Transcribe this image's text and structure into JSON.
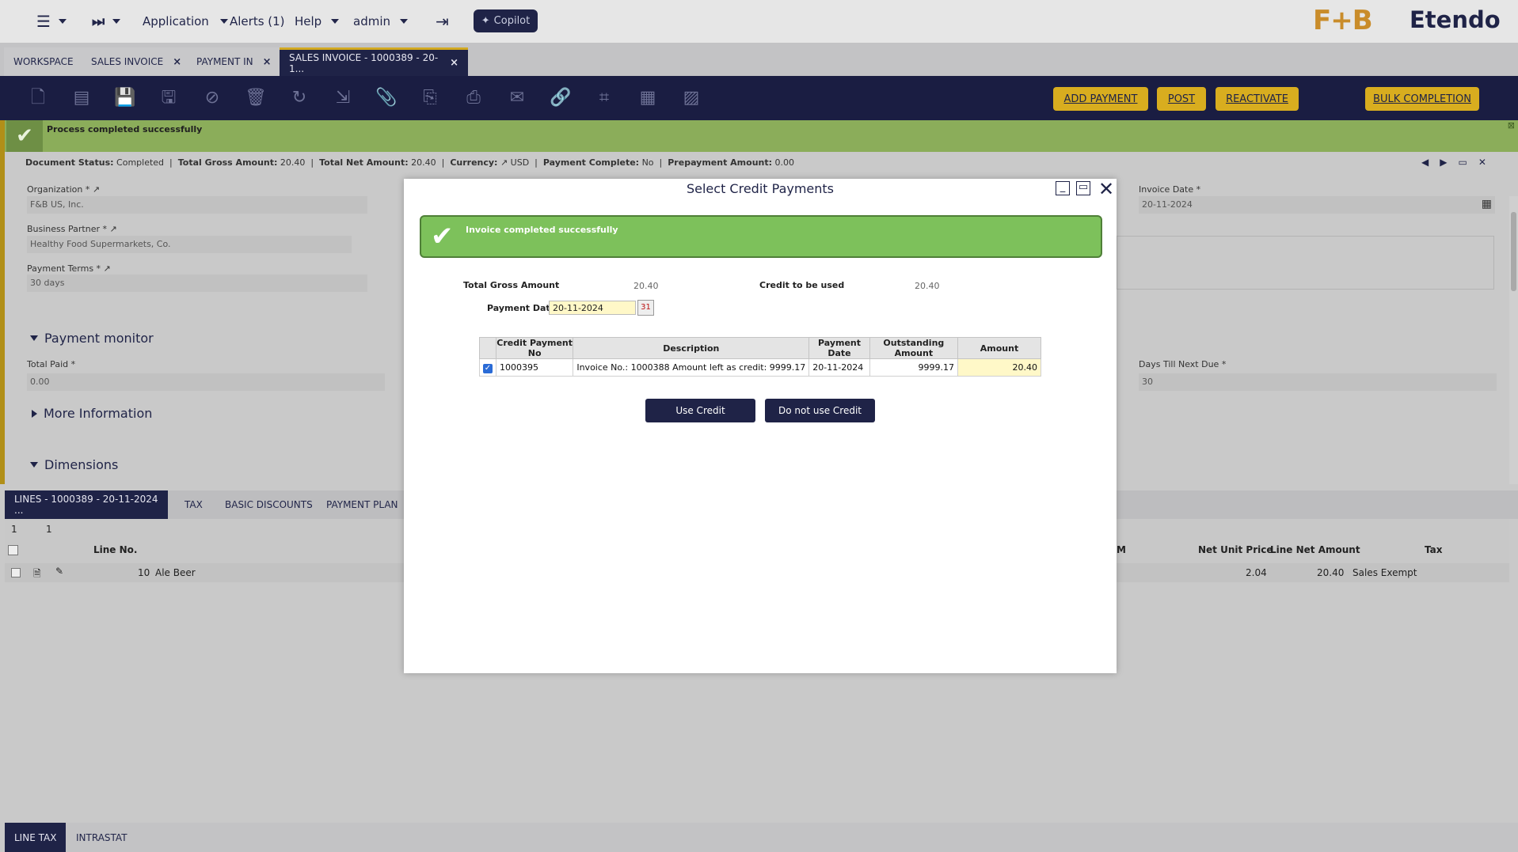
{
  "topbar": {
    "menu_application": "Application",
    "menu_alerts": "Alerts (1)",
    "menu_help": "Help",
    "menu_user": "admin",
    "copilot": "Copilot",
    "logo_fb": "F+B",
    "logo_etendo": "Etendo"
  },
  "tabs": [
    {
      "label": "WORKSPACE"
    },
    {
      "label": "SALES INVOICE"
    },
    {
      "label": "PAYMENT IN"
    },
    {
      "label": "SALES INVOICE - 1000389 - 20-1..."
    }
  ],
  "toolbar": {
    "add_payment": "ADD PAYMENT",
    "post": "POST",
    "reactivate": "REACTIVATE",
    "bulk_completion": "BULK COMPLETION"
  },
  "success": {
    "message": "Process completed successfully"
  },
  "status": {
    "doc_status_label": "Document Status:",
    "doc_status_value": "Completed",
    "gross_label": "Total Gross Amount:",
    "gross_value": "20.40",
    "net_label": "Total Net Amount:",
    "net_value": "20.40",
    "currency_label": "Currency:",
    "currency_value": "USD",
    "payment_complete_label": "Payment Complete:",
    "payment_complete_value": "No",
    "prepayment_label": "Prepayment Amount:",
    "prepayment_value": "0.00"
  },
  "form": {
    "org_label": "Organization *",
    "org_value": "F&B US, Inc.",
    "bp_label": "Business Partner *",
    "bp_value": "Healthy Food Supermarkets, Co.",
    "terms_label": "Payment Terms *",
    "terms_value": "30 days",
    "invoice_date_label": "Invoice Date *",
    "invoice_date_value": "20-11-2024",
    "total_paid_label": "Total Paid *",
    "total_paid_value": "0.00",
    "days_label": "Days Till Next Due *",
    "days_value": "30"
  },
  "sections": {
    "payment_monitor": "Payment monitor",
    "more_info": "More Information",
    "dimensions": "Dimensions"
  },
  "lower_tabs": [
    {
      "label": "LINES - 1000389 - 20-11-2024 ..."
    },
    {
      "label": "TAX"
    },
    {
      "label": "BASIC DISCOUNTS"
    },
    {
      "label": "PAYMENT PLAN"
    }
  ],
  "grid": {
    "page": "1",
    "count": "1",
    "col_line_no": "Line No.",
    "col_net_unit_price": "Net Unit Price",
    "col_line_net_amount": "Line Net Amount",
    "col_tax": "Tax",
    "col_partial": "M",
    "row": {
      "line_no": "10",
      "product": "Ale Beer",
      "net_unit_price": "2.04",
      "line_net_amount": "20.40",
      "tax": "Sales Exempt"
    }
  },
  "bottom_tabs": [
    {
      "label": "LINE TAX"
    },
    {
      "label": "INTRASTAT"
    }
  ],
  "modal": {
    "title": "Select Credit Payments",
    "success_message": "Invoice completed successfully",
    "total_gross_label": "Total Gross Amount",
    "total_gross_value": "20.40",
    "credit_label": "Credit to be used",
    "credit_value": "20.40",
    "payment_date_label": "Payment Date",
    "payment_date_value": "20-11-2024",
    "table": {
      "headers": [
        "Credit Payment No",
        "Description",
        "Payment Date",
        "Outstanding Amount",
        "Amount"
      ],
      "rows": [
        {
          "payment_no": "1000395",
          "description": "Invoice No.: 1000388 Amount left as credit: 9999.17",
          "payment_date": "20-11-2024",
          "outstanding": "9999.17",
          "amount": "20.40"
        }
      ]
    },
    "use_credit": "Use Credit",
    "do_not_use_credit": "Do not use Credit"
  }
}
